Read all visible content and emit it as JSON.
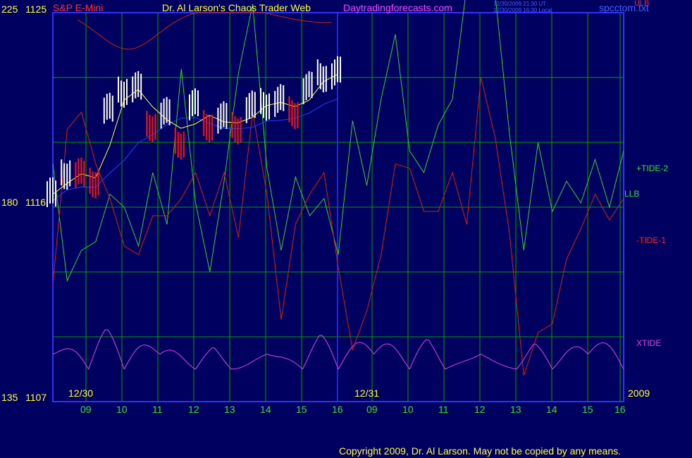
{
  "header": {
    "instrument": "S&P E-Mini",
    "title": "Dr. Al Larson's Chaos Trader Web",
    "site": "Daytradingforecasts.com",
    "timestamp_ut": "12/30/2009 21:30 UT",
    "timestamp_local": "12/30/2009 16:30 Local",
    "file": "spcctom.txt",
    "ulb": "ULB"
  },
  "left_axis": {
    "top": {
      "a": "225",
      "b": "1125"
    },
    "mid": {
      "a": "180",
      "b": "1116"
    },
    "bot": {
      "a": "135",
      "b": "1107"
    }
  },
  "right_labels": {
    "tide2": "+TIDE-2",
    "llb": "LLB",
    "tide1": "-TIDE-1",
    "xtide": "XTIDE",
    "year": "2009"
  },
  "dates": {
    "d1": "12/30",
    "d2": "12/31"
  },
  "x_ticks": [
    "09",
    "10",
    "11",
    "12",
    "13",
    "14",
    "15",
    "16",
    "09",
    "10",
    "11",
    "12",
    "13",
    "14",
    "15",
    "16"
  ],
  "copyright": "Copyright 2009, Dr. Al Larson. May not be copied by any means.",
  "colors": {
    "background": "#000060",
    "grid": "#00a000",
    "frame": "#3030ff",
    "price_up": "#ffffff",
    "price_down": "#ff1010",
    "tide2": "#30d030",
    "tide1": "#d02010",
    "xtide": "#e040e0",
    "ma_fast": "#ffff40",
    "ma_slow": "#2040ff",
    "text_yellow": "#ffff30"
  },
  "chart_data": {
    "type": "line",
    "title": "S&P E-Mini",
    "x": [
      "09",
      "10",
      "11",
      "12",
      "13",
      "14",
      "15",
      "16",
      "09",
      "10",
      "11",
      "12",
      "13",
      "14",
      "15",
      "16"
    ],
    "ylim_price": [
      1107,
      1125
    ],
    "ylim_osc": [
      135,
      225
    ],
    "series": [
      {
        "name": "+TIDE-2",
        "values": [
          190,
          163,
          170,
          172,
          183,
          180,
          171,
          188,
          176,
          212,
          181,
          165,
          186,
          211,
          227,
          189,
          170,
          187,
          178,
          182,
          169,
          200,
          185,
          205,
          220,
          193,
          188,
          199,
          205,
          231,
          235,
          229,
          197,
          170,
          195,
          179,
          186,
          181,
          191,
          180,
          193
        ]
      },
      {
        "name": "-TIDE-1",
        "values": [
          162,
          198,
          202,
          190,
          182,
          171,
          169,
          178,
          178,
          182,
          188,
          178,
          188,
          173,
          202,
          183,
          154,
          176,
          183,
          188,
          166,
          147,
          156,
          169,
          190,
          189,
          179,
          179,
          188,
          176,
          210,
          196,
          174,
          141,
          151,
          153,
          168,
          175,
          183,
          177,
          182
        ]
      },
      {
        "name": "XTIDE",
        "values": [
          141,
          140,
          142,
          141,
          139,
          141,
          140,
          139,
          141,
          140,
          141,
          139,
          140,
          141,
          142,
          140,
          139,
          141,
          140,
          141,
          139,
          140,
          141,
          142,
          140,
          141,
          140,
          139,
          141,
          140,
          141,
          140,
          139,
          141,
          140,
          139,
          140,
          141,
          140,
          139,
          142
        ]
      },
      {
        "name": "S&P E-Mini",
        "values": [
          1116.6,
          1117.6,
          1117.5,
          1117.2,
          1120.5,
          1121.4,
          1121.5,
          1119.8,
          1120.3,
          1119.0,
          1120.7,
          1119.8,
          1120.1,
          1119.7,
          1120.6,
          1120.8,
          1120.9,
          1120.4,
          1121.5,
          1122.1,
          1122.2
        ]
      }
    ]
  }
}
